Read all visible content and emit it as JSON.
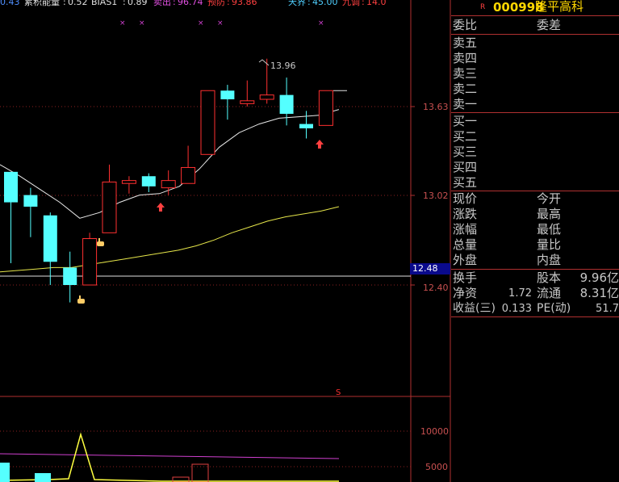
{
  "indicators": {
    "first_value": "0.43",
    "energy_label": "累积能量",
    "energy_value": "0.52",
    "bias_label": "BIAS1",
    "bias_value": "0.89",
    "sell_label": "卖出",
    "sell_value": "96.74",
    "warn_label": "预防",
    "warn_value": "93.86",
    "sky_label": "天界",
    "sky_value": "45.00",
    "space_label": "九调",
    "space_value": "14.0"
  },
  "chart_data": {
    "type": "candlestick",
    "y_ticks": [
      "13.63",
      "13.02",
      "12.40"
    ],
    "last_price_label": "12.48",
    "high_annotation": "13.96",
    "volume_ticks": [
      "10000",
      "5000"
    ],
    "signal_marker": "S",
    "candles": [
      {
        "open": 13.18,
        "close": 12.97,
        "high": 13.18,
        "low": 12.55,
        "color": "cyan"
      },
      {
        "open": 13.02,
        "close": 12.94,
        "high": 13.07,
        "low": 12.73,
        "color": "cyan"
      },
      {
        "open": 12.88,
        "close": 12.56,
        "high": 12.9,
        "low": 12.4,
        "color": "cyan"
      },
      {
        "open": 12.52,
        "close": 12.4,
        "high": 12.63,
        "low": 12.28,
        "color": "cyan"
      },
      {
        "open": 12.4,
        "close": 12.72,
        "high": 12.76,
        "low": 12.4,
        "color": "red"
      },
      {
        "open": 12.76,
        "close": 13.11,
        "high": 13.23,
        "low": 12.76,
        "color": "red"
      },
      {
        "open": 13.1,
        "close": 13.12,
        "high": 13.15,
        "low": 13.03,
        "color": "red"
      },
      {
        "open": 13.15,
        "close": 13.08,
        "high": 13.17,
        "low": 13.04,
        "color": "cyan"
      },
      {
        "open": 13.07,
        "close": 13.12,
        "high": 13.19,
        "low": 13.02,
        "color": "red"
      },
      {
        "open": 13.1,
        "close": 13.21,
        "high": 13.36,
        "low": 13.1,
        "color": "red"
      },
      {
        "open": 13.3,
        "close": 13.74,
        "high": 13.74,
        "low": 13.3,
        "color": "red"
      },
      {
        "open": 13.74,
        "close": 13.68,
        "high": 13.78,
        "low": 13.54,
        "color": "cyan"
      },
      {
        "open": 13.65,
        "close": 13.67,
        "high": 13.81,
        "low": 13.63,
        "color": "red"
      },
      {
        "open": 13.68,
        "close": 13.71,
        "high": 13.96,
        "low": 13.65,
        "color": "red"
      },
      {
        "open": 13.71,
        "close": 13.58,
        "high": 13.83,
        "low": 13.5,
        "color": "cyan"
      },
      {
        "open": 13.51,
        "close": 13.48,
        "high": 13.6,
        "low": 13.41,
        "color": "cyan"
      },
      {
        "open": 13.5,
        "close": 13.74,
        "high": 13.74,
        "low": 13.5,
        "color": "red"
      }
    ],
    "ma_short": [
      13.23,
      13.15,
      13.06,
      12.97,
      12.86,
      12.9,
      12.97,
      13.02,
      13.03,
      13.08,
      13.2,
      13.35,
      13.45,
      13.51,
      13.55,
      13.56,
      13.57,
      13.61
    ],
    "ma_long": [
      12.49,
      12.5,
      12.51,
      12.52,
      12.52,
      12.54,
      12.56,
      12.58,
      12.6,
      12.62,
      12.64,
      12.67,
      12.71,
      12.76,
      12.8,
      12.84,
      12.87,
      12.89,
      12.91,
      12.94
    ],
    "volume_area_max": 12000
  },
  "panel": {
    "code_prefix": "R",
    "code": "000998",
    "name": "隆平高科",
    "wei_bi": "委比",
    "wei_cha": "委差",
    "sell_rows": [
      "卖五",
      "卖四",
      "卖三",
      "卖二",
      "卖一"
    ],
    "buy_rows": [
      "买一",
      "买二",
      "买三",
      "买四",
      "买五"
    ],
    "quote_left": [
      "现价",
      "涨跌",
      "涨幅",
      "总量",
      "外盘"
    ],
    "quote_right": [
      "今开",
      "最高",
      "最低",
      "量比",
      "内盘"
    ],
    "turnover_label": "换手",
    "share_cap_label": "股本",
    "share_cap_value": "9.96亿",
    "net_asset_label": "净资",
    "net_asset_value": "1.72",
    "float_label": "流通",
    "float_value": "8.31亿",
    "eps_label": "收益(三)",
    "eps_value": "0.133",
    "pe_label": "PE(动)",
    "pe_value": "51.7"
  }
}
